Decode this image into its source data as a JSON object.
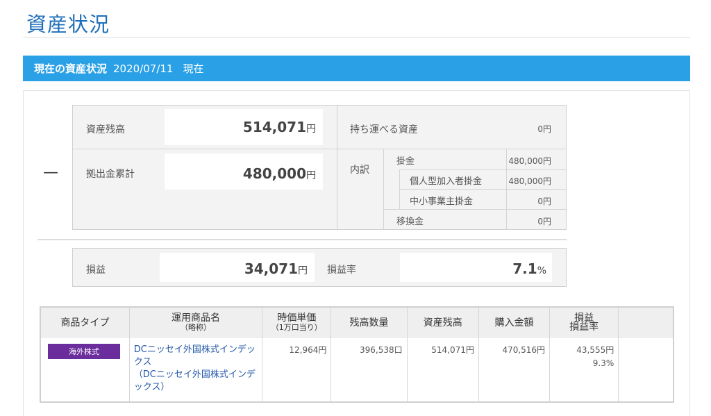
{
  "page": {
    "title": "資産状況"
  },
  "header_bar": {
    "title": "現在の資産状況",
    "date": "2020/07/11",
    "suffix": "現在"
  },
  "toggle": {
    "symbol": "—"
  },
  "summary": {
    "asset_balance": {
      "label": "資産残高",
      "value": "514,071",
      "unit": "円"
    },
    "contribution_total": {
      "label": "拠出金累計",
      "value": "480,000",
      "unit": "円"
    },
    "portable_assets": {
      "label": "持ち運べる資産",
      "value": "0円"
    },
    "breakdown": {
      "label": "内訳",
      "rows": [
        {
          "label": "掛金",
          "value": "480,000円"
        },
        {
          "label": "個人型加入者掛金",
          "value": "480,000円"
        },
        {
          "label": "中小事業主掛金",
          "value": "0円"
        },
        {
          "label": "移換金",
          "value": "0円"
        }
      ]
    }
  },
  "profit": {
    "label": "損益",
    "value": "34,071",
    "unit": "円",
    "rate_label": "損益率",
    "rate_value": "7.1",
    "rate_unit": "%"
  },
  "holdings_table": {
    "headers": {
      "type": "商品タイプ",
      "name": "運用商品名",
      "name_sub": "（略称）",
      "price": "時価単価",
      "price_sub": "（1万口当り）",
      "quantity": "残高数量",
      "balance": "資産残高",
      "purchase": "購入金額",
      "pl": "損益",
      "pl_rate": "損益率"
    },
    "rows": [
      {
        "type": "海外株式",
        "name": "DCニッセイ外国株式インデックス",
        "name_abbr": "（DCニッセイ外国株式インデックス）",
        "price": "12,964円",
        "quantity": "396,538口",
        "balance": "514,071円",
        "purchase": "470,516円",
        "pl": "43,555円",
        "pl_rate": "9.3%"
      }
    ]
  },
  "colors": {
    "title": "#1f6fb8",
    "bar": "#2aa0e6",
    "badge": "#6b2d9b",
    "link": "#2357a8"
  }
}
